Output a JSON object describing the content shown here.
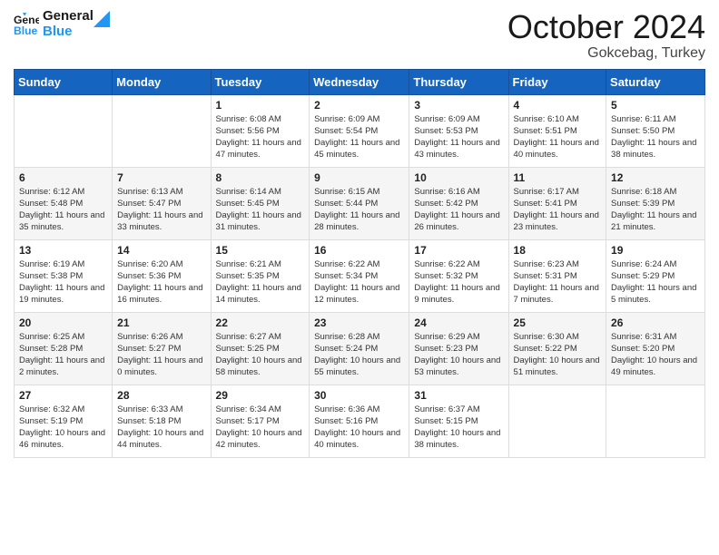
{
  "header": {
    "logo_line1": "General",
    "logo_line2": "Blue",
    "title": "October 2024",
    "subtitle": "Gokcebag, Turkey"
  },
  "weekdays": [
    "Sunday",
    "Monday",
    "Tuesday",
    "Wednesday",
    "Thursday",
    "Friday",
    "Saturday"
  ],
  "weeks": [
    [
      {
        "day": "",
        "sunrise": "",
        "sunset": "",
        "daylight": ""
      },
      {
        "day": "",
        "sunrise": "",
        "sunset": "",
        "daylight": ""
      },
      {
        "day": "1",
        "sunrise": "Sunrise: 6:08 AM",
        "sunset": "Sunset: 5:56 PM",
        "daylight": "Daylight: 11 hours and 47 minutes."
      },
      {
        "day": "2",
        "sunrise": "Sunrise: 6:09 AM",
        "sunset": "Sunset: 5:54 PM",
        "daylight": "Daylight: 11 hours and 45 minutes."
      },
      {
        "day": "3",
        "sunrise": "Sunrise: 6:09 AM",
        "sunset": "Sunset: 5:53 PM",
        "daylight": "Daylight: 11 hours and 43 minutes."
      },
      {
        "day": "4",
        "sunrise": "Sunrise: 6:10 AM",
        "sunset": "Sunset: 5:51 PM",
        "daylight": "Daylight: 11 hours and 40 minutes."
      },
      {
        "day": "5",
        "sunrise": "Sunrise: 6:11 AM",
        "sunset": "Sunset: 5:50 PM",
        "daylight": "Daylight: 11 hours and 38 minutes."
      }
    ],
    [
      {
        "day": "6",
        "sunrise": "Sunrise: 6:12 AM",
        "sunset": "Sunset: 5:48 PM",
        "daylight": "Daylight: 11 hours and 35 minutes."
      },
      {
        "day": "7",
        "sunrise": "Sunrise: 6:13 AM",
        "sunset": "Sunset: 5:47 PM",
        "daylight": "Daylight: 11 hours and 33 minutes."
      },
      {
        "day": "8",
        "sunrise": "Sunrise: 6:14 AM",
        "sunset": "Sunset: 5:45 PM",
        "daylight": "Daylight: 11 hours and 31 minutes."
      },
      {
        "day": "9",
        "sunrise": "Sunrise: 6:15 AM",
        "sunset": "Sunset: 5:44 PM",
        "daylight": "Daylight: 11 hours and 28 minutes."
      },
      {
        "day": "10",
        "sunrise": "Sunrise: 6:16 AM",
        "sunset": "Sunset: 5:42 PM",
        "daylight": "Daylight: 11 hours and 26 minutes."
      },
      {
        "day": "11",
        "sunrise": "Sunrise: 6:17 AM",
        "sunset": "Sunset: 5:41 PM",
        "daylight": "Daylight: 11 hours and 23 minutes."
      },
      {
        "day": "12",
        "sunrise": "Sunrise: 6:18 AM",
        "sunset": "Sunset: 5:39 PM",
        "daylight": "Daylight: 11 hours and 21 minutes."
      }
    ],
    [
      {
        "day": "13",
        "sunrise": "Sunrise: 6:19 AM",
        "sunset": "Sunset: 5:38 PM",
        "daylight": "Daylight: 11 hours and 19 minutes."
      },
      {
        "day": "14",
        "sunrise": "Sunrise: 6:20 AM",
        "sunset": "Sunset: 5:36 PM",
        "daylight": "Daylight: 11 hours and 16 minutes."
      },
      {
        "day": "15",
        "sunrise": "Sunrise: 6:21 AM",
        "sunset": "Sunset: 5:35 PM",
        "daylight": "Daylight: 11 hours and 14 minutes."
      },
      {
        "day": "16",
        "sunrise": "Sunrise: 6:22 AM",
        "sunset": "Sunset: 5:34 PM",
        "daylight": "Daylight: 11 hours and 12 minutes."
      },
      {
        "day": "17",
        "sunrise": "Sunrise: 6:22 AM",
        "sunset": "Sunset: 5:32 PM",
        "daylight": "Daylight: 11 hours and 9 minutes."
      },
      {
        "day": "18",
        "sunrise": "Sunrise: 6:23 AM",
        "sunset": "Sunset: 5:31 PM",
        "daylight": "Daylight: 11 hours and 7 minutes."
      },
      {
        "day": "19",
        "sunrise": "Sunrise: 6:24 AM",
        "sunset": "Sunset: 5:29 PM",
        "daylight": "Daylight: 11 hours and 5 minutes."
      }
    ],
    [
      {
        "day": "20",
        "sunrise": "Sunrise: 6:25 AM",
        "sunset": "Sunset: 5:28 PM",
        "daylight": "Daylight: 11 hours and 2 minutes."
      },
      {
        "day": "21",
        "sunrise": "Sunrise: 6:26 AM",
        "sunset": "Sunset: 5:27 PM",
        "daylight": "Daylight: 11 hours and 0 minutes."
      },
      {
        "day": "22",
        "sunrise": "Sunrise: 6:27 AM",
        "sunset": "Sunset: 5:25 PM",
        "daylight": "Daylight: 10 hours and 58 minutes."
      },
      {
        "day": "23",
        "sunrise": "Sunrise: 6:28 AM",
        "sunset": "Sunset: 5:24 PM",
        "daylight": "Daylight: 10 hours and 55 minutes."
      },
      {
        "day": "24",
        "sunrise": "Sunrise: 6:29 AM",
        "sunset": "Sunset: 5:23 PM",
        "daylight": "Daylight: 10 hours and 53 minutes."
      },
      {
        "day": "25",
        "sunrise": "Sunrise: 6:30 AM",
        "sunset": "Sunset: 5:22 PM",
        "daylight": "Daylight: 10 hours and 51 minutes."
      },
      {
        "day": "26",
        "sunrise": "Sunrise: 6:31 AM",
        "sunset": "Sunset: 5:20 PM",
        "daylight": "Daylight: 10 hours and 49 minutes."
      }
    ],
    [
      {
        "day": "27",
        "sunrise": "Sunrise: 6:32 AM",
        "sunset": "Sunset: 5:19 PM",
        "daylight": "Daylight: 10 hours and 46 minutes."
      },
      {
        "day": "28",
        "sunrise": "Sunrise: 6:33 AM",
        "sunset": "Sunset: 5:18 PM",
        "daylight": "Daylight: 10 hours and 44 minutes."
      },
      {
        "day": "29",
        "sunrise": "Sunrise: 6:34 AM",
        "sunset": "Sunset: 5:17 PM",
        "daylight": "Daylight: 10 hours and 42 minutes."
      },
      {
        "day": "30",
        "sunrise": "Sunrise: 6:36 AM",
        "sunset": "Sunset: 5:16 PM",
        "daylight": "Daylight: 10 hours and 40 minutes."
      },
      {
        "day": "31",
        "sunrise": "Sunrise: 6:37 AM",
        "sunset": "Sunset: 5:15 PM",
        "daylight": "Daylight: 10 hours and 38 minutes."
      },
      {
        "day": "",
        "sunrise": "",
        "sunset": "",
        "daylight": ""
      },
      {
        "day": "",
        "sunrise": "",
        "sunset": "",
        "daylight": ""
      }
    ]
  ]
}
